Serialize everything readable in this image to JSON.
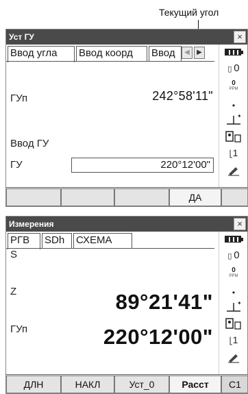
{
  "callout": {
    "text": "Текущий угол"
  },
  "panel1": {
    "title": "Уст ГУ",
    "close": "×",
    "tabs": [
      "Ввод угла",
      "Ввод коорд",
      "Ввод"
    ],
    "fields": {
      "hz_label": "ГУп",
      "hz_value": "242°58'11\"",
      "input_title": "Ввод ГУ",
      "gu_label": "ГУ",
      "gu_value": "220°12'00\""
    },
    "softkeys": [
      "",
      "",
      "",
      "ДА",
      ""
    ],
    "sidebar": {
      "prism": "0",
      "ppm_val": "0",
      "ppm_label": "PPM",
      "dot": "•",
      "num": "1"
    }
  },
  "panel2": {
    "title": "Измерения",
    "close": "×",
    "tabs": [
      "РГВ",
      "SDh",
      "СХЕМА"
    ],
    "fields": {
      "s_label": "S",
      "s_value": "",
      "z_label": "Z",
      "z_value": "89°21'41\"",
      "hz_label": "ГУп",
      "hz_value": "220°12'00\""
    },
    "softkeys": [
      "ДЛН",
      "НАКЛ",
      "Уст_0",
      "Расст",
      "C1"
    ],
    "sidebar": {
      "prism": "0",
      "ppm_val": "0",
      "ppm_label": "PPM",
      "dot": "•",
      "num": "1"
    }
  },
  "icons": [
    "battery-icon",
    "prism-icon",
    "ppm-icon",
    "tilt-icon",
    "target-icon",
    "level-icon",
    "pencil-icon"
  ]
}
